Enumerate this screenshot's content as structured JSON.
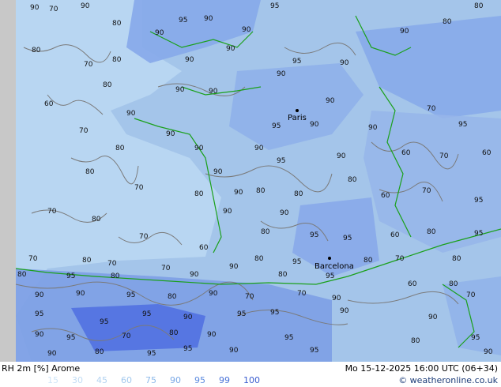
{
  "map": {
    "cities": [
      {
        "name": "Paris"
      },
      {
        "name": "Barcelona"
      }
    ],
    "contour_labels": [
      "60",
      "70",
      "80",
      "90",
      "95"
    ],
    "colors": {
      "land_base": "#a7c7ea",
      "sea": "#b7d7f2",
      "high_rh": "#7f9fe6",
      "very_high_rh": "#4f6fe0",
      "contour": "#707070",
      "border": "#1aa01a"
    }
  },
  "footer": {
    "left_title": "RH 2m [%] Arome",
    "right_title": "Mo 15-12-2025 16:00 UTC (06+34)",
    "legend_values": [
      "15",
      "30",
      "45",
      "60",
      "75",
      "90",
      "95",
      "99",
      "100"
    ],
    "legend_colors": [
      "#d0e6f8",
      "#c2ddf5",
      "#b3d3f1",
      "#a3c9ee",
      "#8fbbea",
      "#7aa8e6",
      "#5f8de0",
      "#4a73d8",
      "#3a5ccf"
    ],
    "credit": "© weatheronline.co.uk"
  }
}
